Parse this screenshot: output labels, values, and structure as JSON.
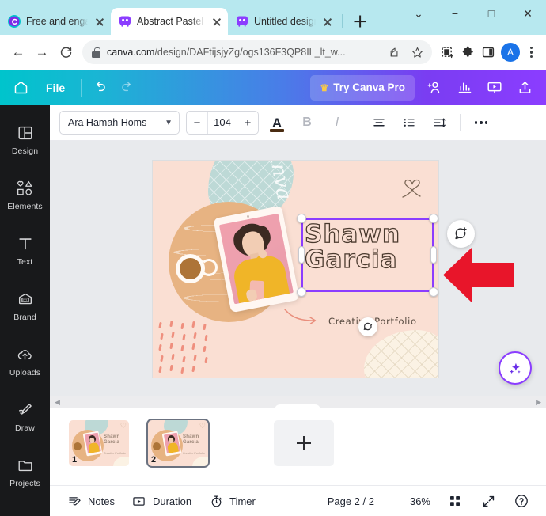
{
  "browser": {
    "tabs": [
      {
        "title": "Free and engag",
        "favicon": "canva-c-icon",
        "active": false
      },
      {
        "title": "Abstract Pastel",
        "favicon": "canva-icon",
        "active": true
      },
      {
        "title": "Untitled design",
        "favicon": "canva-icon",
        "active": false
      }
    ],
    "new_tab_label": "+",
    "window_controls": {
      "tab_search": "⌄",
      "minimize": "−",
      "maximize": "□",
      "close": "✕"
    },
    "nav": {
      "back": "←",
      "forward": "→",
      "reload": "⟳"
    },
    "omnibox": {
      "url_domain": "canva.com",
      "url_path": "/design/DAFtijsjyZg/ogs136F3QP8IL_lt_w...",
      "share_icon": "share-icon",
      "bookmark_icon": "star-icon"
    },
    "toolbar_icons": [
      "reader-mode-icon",
      "extensions-puzzle-icon",
      "side-panel-icon"
    ],
    "profile_initial": "A"
  },
  "canva_header": {
    "home_icon": "home-icon",
    "file_label": "File",
    "undo_icon": "undo-icon",
    "redo_icon": "redo-icon",
    "pro_button": {
      "label": "Try Canva Pro",
      "crown_icon": "crown-icon"
    },
    "right_icons": [
      "add-collaborator-icon",
      "analytics-icon",
      "present-icon",
      "share-upload-icon"
    ]
  },
  "text_toolbar": {
    "font_family": "Ara Hamah Homs",
    "font_dropdown_icon": "chevron-down-icon",
    "font_size_decrease": "−",
    "font_size": "104",
    "font_size_increase": "+",
    "text_color_label": "A",
    "text_color": "#4a2c12",
    "bold_label": "B",
    "italic_label": "I",
    "align_icon": "align-center-icon",
    "list_icon": "bullet-list-icon",
    "spacing_icon": "line-spacing-icon",
    "more_icon": "more-options-icon"
  },
  "sidebar": {
    "items": [
      {
        "label": "Design",
        "icon": "design-layout-icon"
      },
      {
        "label": "Elements",
        "icon": "elements-shapes-icon"
      },
      {
        "label": "Text",
        "icon": "text-t-icon"
      },
      {
        "label": "Brand",
        "icon": "brand-tag-icon"
      },
      {
        "label": "Uploads",
        "icon": "upload-cloud-icon"
      },
      {
        "label": "Draw",
        "icon": "draw-pen-icon"
      },
      {
        "label": "Projects",
        "icon": "folder-icon"
      }
    ]
  },
  "canvas": {
    "design_title": "Shawn\nGarcia",
    "design_title_line1": "Shawn",
    "design_title_line2": "Garcia",
    "design_subtitle": "Creative Portfolio",
    "watermark_script": "Canva",
    "background_color": "#fadfd3",
    "selection_color": "#8b3dff",
    "rotate_icon": "rotate-icon",
    "comment_icon": "add-comment-icon",
    "magic_icon": "magic-sparkle-icon",
    "annotation_arrow": {
      "icon": "red-arrow-left",
      "color": "#e8152a"
    }
  },
  "pages_strip": {
    "scroll_left_icon": "chevron-left-icon",
    "scroll_right_icon": "chevron-right-icon",
    "collapse_icon": "chevron-down-icon",
    "thumbnails": [
      {
        "number": "1",
        "selected": false,
        "title_line1": "Shawn",
        "title_line2": "Garcia",
        "subtitle": "Creative Portfolio"
      },
      {
        "number": "2",
        "selected": true,
        "title_line1": "Shawn",
        "title_line2": "Garcia",
        "subtitle": "Creative Portfolio"
      }
    ],
    "add_page_label": "+"
  },
  "bottom_bar": {
    "notes": {
      "label": "Notes",
      "icon": "notes-icon"
    },
    "duration": {
      "label": "Duration",
      "icon": "duration-icon"
    },
    "timer": {
      "label": "Timer",
      "icon": "timer-icon"
    },
    "page_indicator": "Page 2 / 2",
    "zoom_level": "36%",
    "grid_icon": "grid-view-icon",
    "fullscreen_icon": "fullscreen-icon",
    "help_icon": "help-icon"
  }
}
